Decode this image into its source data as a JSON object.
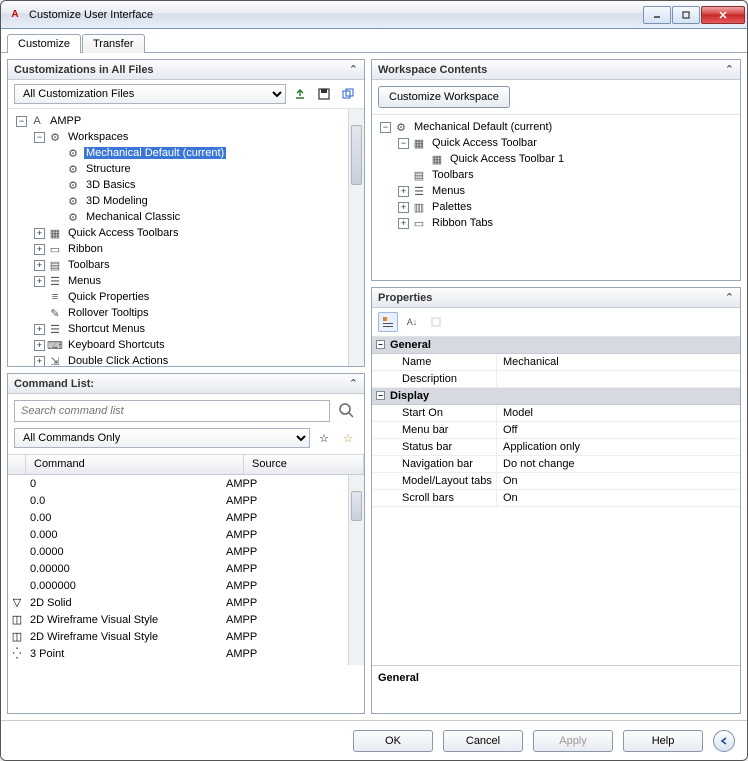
{
  "window": {
    "title": "Customize User Interface"
  },
  "tabs": {
    "customize": "Customize",
    "transfer": "Transfer"
  },
  "custPanel": {
    "title": "Customizations in All Files",
    "combo": "All Customization Files",
    "tree": [
      {
        "depth": 0,
        "exp": "-",
        "icon": "app",
        "label": "AMPP"
      },
      {
        "depth": 1,
        "exp": "-",
        "icon": "gear",
        "label": "Workspaces"
      },
      {
        "depth": 2,
        "exp": "",
        "icon": "gear",
        "label": "Mechanical Default (current)",
        "selected": true
      },
      {
        "depth": 2,
        "exp": "",
        "icon": "gear",
        "label": "Structure"
      },
      {
        "depth": 2,
        "exp": "",
        "icon": "gear",
        "label": "3D Basics"
      },
      {
        "depth": 2,
        "exp": "",
        "icon": "gear",
        "label": "3D Modeling"
      },
      {
        "depth": 2,
        "exp": "",
        "icon": "gear",
        "label": "Mechanical Classic"
      },
      {
        "depth": 1,
        "exp": "+",
        "icon": "qat",
        "label": "Quick Access Toolbars"
      },
      {
        "depth": 1,
        "exp": "+",
        "icon": "ribbon",
        "label": "Ribbon"
      },
      {
        "depth": 1,
        "exp": "+",
        "icon": "toolbar",
        "label": "Toolbars"
      },
      {
        "depth": 1,
        "exp": "+",
        "icon": "menu",
        "label": "Menus"
      },
      {
        "depth": 1,
        "exp": "",
        "icon": "props",
        "label": "Quick Properties"
      },
      {
        "depth": 1,
        "exp": "",
        "icon": "tooltip",
        "label": "Rollover Tooltips"
      },
      {
        "depth": 1,
        "exp": "+",
        "icon": "menu",
        "label": "Shortcut Menus"
      },
      {
        "depth": 1,
        "exp": "+",
        "icon": "keys",
        "label": "Keyboard Shortcuts"
      },
      {
        "depth": 1,
        "exp": "+",
        "icon": "dblclick",
        "label": "Double Click Actions"
      }
    ]
  },
  "cmdPanel": {
    "title": "Command List:",
    "searchPlaceholder": "Search command list",
    "filter": "All Commands Only",
    "headers": {
      "command": "Command",
      "source": "Source"
    },
    "rows": [
      {
        "icon": "",
        "cmd": "0",
        "src": "AMPP"
      },
      {
        "icon": "",
        "cmd": "0.0",
        "src": "AMPP"
      },
      {
        "icon": "",
        "cmd": "0.00",
        "src": "AMPP"
      },
      {
        "icon": "",
        "cmd": "0.000",
        "src": "AMPP"
      },
      {
        "icon": "",
        "cmd": "0.0000",
        "src": "AMPP"
      },
      {
        "icon": "",
        "cmd": "0.00000",
        "src": "AMPP"
      },
      {
        "icon": "",
        "cmd": "0.000000",
        "src": "AMPP"
      },
      {
        "icon": "cup",
        "cmd": "2D Solid",
        "src": "AMPP"
      },
      {
        "icon": "wire",
        "cmd": "2D Wireframe Visual Style",
        "src": "AMPP"
      },
      {
        "icon": "wire",
        "cmd": "2D Wireframe Visual Style",
        "src": "AMPP"
      },
      {
        "icon": "pts",
        "cmd": "3 Point",
        "src": "AMPP"
      }
    ]
  },
  "wsPanel": {
    "title": "Workspace Contents",
    "button": "Customize Workspace",
    "tree": [
      {
        "depth": 0,
        "exp": "-",
        "icon": "gear",
        "label": "Mechanical Default (current)"
      },
      {
        "depth": 1,
        "exp": "-",
        "icon": "qat",
        "label": "Quick Access Toolbar"
      },
      {
        "depth": 2,
        "exp": "",
        "icon": "qat",
        "label": "Quick Access Toolbar 1"
      },
      {
        "depth": 1,
        "exp": "",
        "icon": "toolbar",
        "label": "Toolbars"
      },
      {
        "depth": 1,
        "exp": "+",
        "icon": "menu",
        "label": "Menus"
      },
      {
        "depth": 1,
        "exp": "+",
        "icon": "palette",
        "label": "Palettes"
      },
      {
        "depth": 1,
        "exp": "+",
        "icon": "ribbon",
        "label": "Ribbon Tabs"
      }
    ]
  },
  "propsPanel": {
    "title": "Properties",
    "cats": [
      {
        "name": "General",
        "rows": [
          {
            "k": "Name",
            "v": "Mechanical"
          },
          {
            "k": "Description",
            "v": ""
          }
        ]
      },
      {
        "name": "Display",
        "rows": [
          {
            "k": "Start On",
            "v": "Model"
          },
          {
            "k": "Menu bar",
            "v": "Off"
          },
          {
            "k": "Status bar",
            "v": "Application only"
          },
          {
            "k": "Navigation bar",
            "v": "Do not change"
          },
          {
            "k": "Model/Layout tabs",
            "v": "On"
          },
          {
            "k": "Scroll bars",
            "v": "On"
          }
        ]
      }
    ],
    "desc": "General"
  },
  "footer": {
    "ok": "OK",
    "cancel": "Cancel",
    "apply": "Apply",
    "help": "Help"
  }
}
